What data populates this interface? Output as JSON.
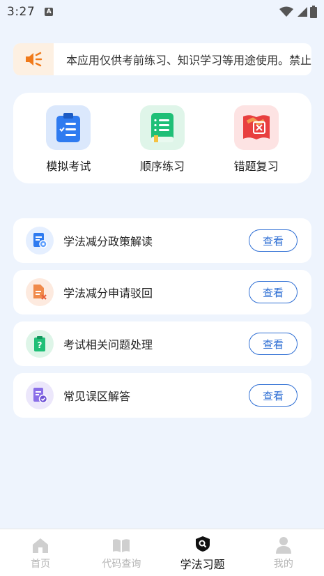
{
  "status_bar": {
    "time": "3:27",
    "notification_icon": "A"
  },
  "notice": {
    "icon": "speaker-icon",
    "text": "本应用仅供考前练习、知识学习等用途使用。禁止"
  },
  "quick_actions": [
    {
      "label": "模拟考试",
      "icon": "clipboard-icon",
      "bg": "#dbe8fc"
    },
    {
      "label": "顺序练习",
      "icon": "book-icon",
      "bg": "#dff5e9"
    },
    {
      "label": "错题复习",
      "icon": "error-book-icon",
      "bg": "#fde3e3"
    }
  ],
  "list_items": [
    {
      "label": "学法减分政策解读",
      "button": "查看",
      "icon": "policy-doc-icon"
    },
    {
      "label": "学法减分申请驳回",
      "button": "查看",
      "icon": "rejected-doc-icon"
    },
    {
      "label": "考试相关问题处理",
      "button": "查看",
      "icon": "question-clipboard-icon"
    },
    {
      "label": "常见误区解答",
      "button": "查看",
      "icon": "checked-doc-icon"
    }
  ],
  "tabbar": [
    {
      "label": "首页",
      "icon": "home-icon",
      "active": false
    },
    {
      "label": "代码查询",
      "icon": "open-book-icon",
      "active": false
    },
    {
      "label": "学法习题",
      "icon": "search-badge-icon",
      "active": true
    },
    {
      "label": "我的",
      "icon": "user-icon",
      "active": false
    }
  ],
  "colors": {
    "background": "#eef4fd",
    "accent_blue": "#2f6fd4",
    "notice_orange": "#f07a1a"
  }
}
